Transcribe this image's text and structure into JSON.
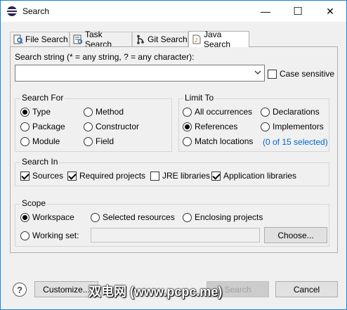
{
  "window": {
    "title": "Search"
  },
  "titlebar": {
    "minimize": "—",
    "maximize": "☐",
    "close": "✕"
  },
  "tabs": [
    {
      "label": "File Search"
    },
    {
      "label": "Task Search"
    },
    {
      "label": "Git Search"
    },
    {
      "label": "Java Search"
    }
  ],
  "search": {
    "string_label": "Search string (* = any string, ? = any character):",
    "value": "",
    "case_sensitive": "Case sensitive",
    "case_sensitive_checked": false
  },
  "search_for": {
    "title": "Search For",
    "options": [
      "Type",
      "Method",
      "Package",
      "Constructor",
      "Module",
      "Field"
    ],
    "selected": "Type"
  },
  "limit_to": {
    "title": "Limit To",
    "options": [
      "All occurrences",
      "Declarations",
      "References",
      "Implementors",
      "Match locations"
    ],
    "selected": "References",
    "selected_link": "(0 of 15 selected)"
  },
  "search_in": {
    "title": "Search In",
    "options": [
      {
        "label": "Sources",
        "checked": true
      },
      {
        "label": "Required projects",
        "checked": true
      },
      {
        "label": "JRE libraries",
        "checked": false
      },
      {
        "label": "Application libraries",
        "checked": true
      }
    ]
  },
  "scope": {
    "title": "Scope",
    "options": [
      "Workspace",
      "Selected resources",
      "Enclosing projects",
      "Working set:"
    ],
    "selected": "Workspace",
    "working_set_value": "",
    "choose_button": "Choose..."
  },
  "footer": {
    "help": "?",
    "customize": "Customize...",
    "search": "Search",
    "cancel": "Cancel"
  },
  "watermark": "双电网 (www.pcpc.me)"
}
